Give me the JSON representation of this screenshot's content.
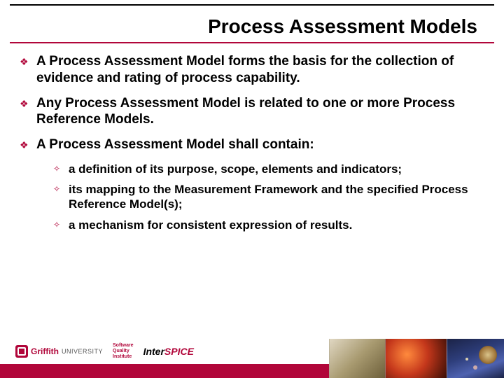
{
  "title": "Process Assessment Models",
  "bullets": [
    {
      "text": "A Process Assessment Model forms the basis for the collection of evidence and rating of process capability."
    },
    {
      "text": "Any Process Assessment Model is related to one or more Process Reference Models."
    },
    {
      "text": "A Process Assessment Model shall contain:"
    }
  ],
  "sub_bullets": [
    {
      "text": "a definition of its purpose, scope, elements and indicators;"
    },
    {
      "text": "its mapping to the Measurement Framework and the specified Process Reference Model(s);"
    },
    {
      "text": "a mechanism for consistent expression of results."
    }
  ],
  "footer": {
    "griffith_name": "Griffith",
    "griffith_uni": "UNIVERSITY",
    "sqi_line1": "Software",
    "sqi_line2": "Quality",
    "sqi_line3": "Institute",
    "interspice_a": "Inter",
    "interspice_b": "SPICE"
  }
}
